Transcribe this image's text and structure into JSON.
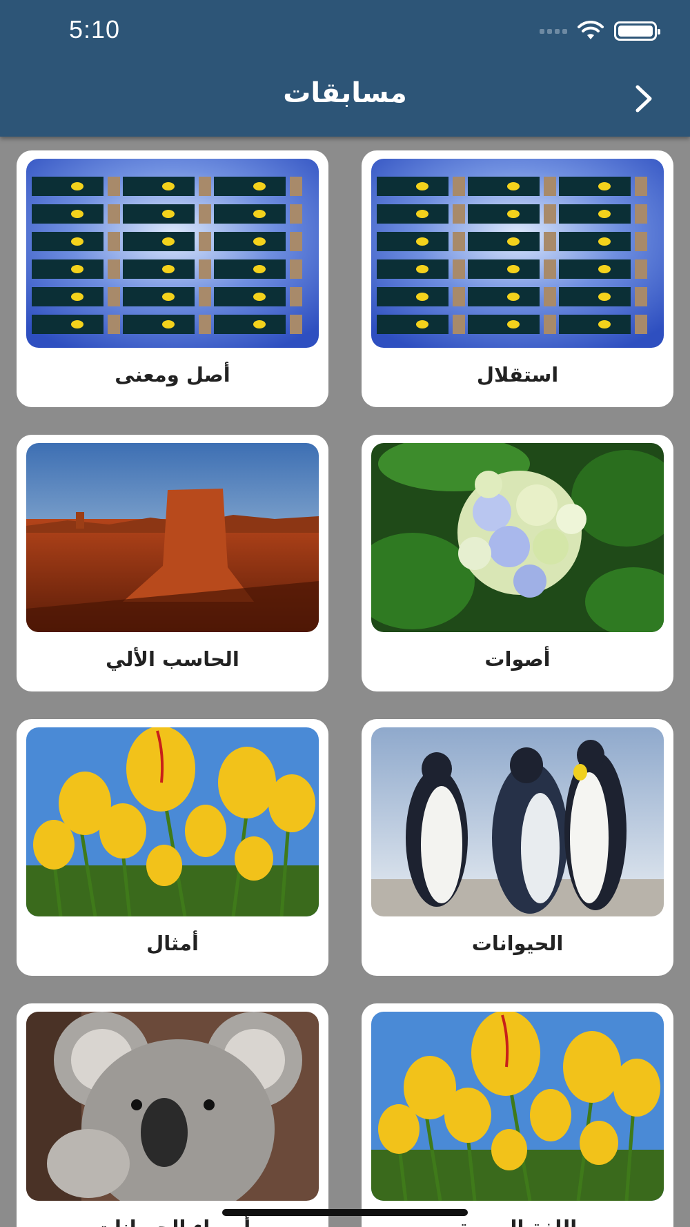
{
  "status_bar": {
    "time": "5:10"
  },
  "header": {
    "title": "مسابقات",
    "back_icon": "chevron-right-icon"
  },
  "cards": [
    {
      "label": "استقلال",
      "image": "weather-temperature-board"
    },
    {
      "label": "أصل ومعنى",
      "image": "weather-temperature-board"
    },
    {
      "label": "أصوات",
      "image": "hydrangea-flower"
    },
    {
      "label": "الحاسب الألي",
      "image": "desert-butte"
    },
    {
      "label": "الحيوانات",
      "image": "penguins"
    },
    {
      "label": "أمثال",
      "image": "yellow-tulips"
    },
    {
      "label": "اللغة العربية",
      "image": "yellow-tulips"
    },
    {
      "label": "أسماء الحيوانات",
      "image": "koala"
    }
  ],
  "colors": {
    "header": "#2d5577",
    "background": "#8c8c8c",
    "card": "#ffffff"
  }
}
